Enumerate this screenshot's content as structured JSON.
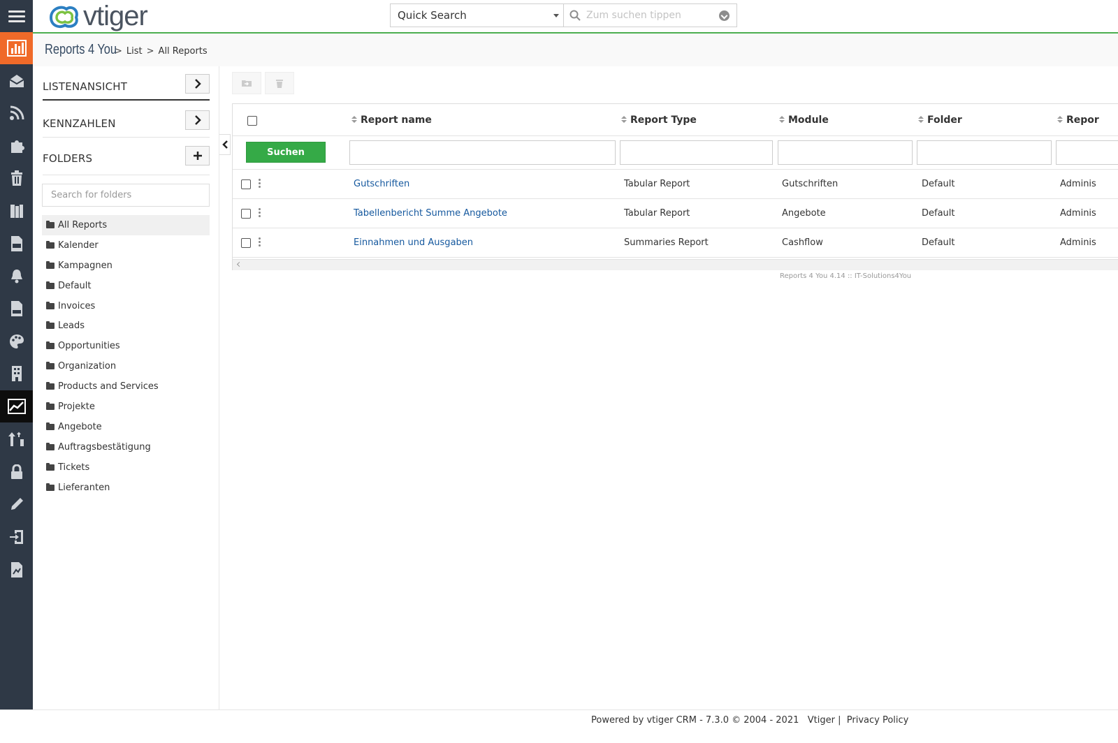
{
  "app": {
    "logo_text": "vtiger"
  },
  "search": {
    "scope_value": "Quick Search",
    "placeholder": "Zum suchen tippen"
  },
  "breadcrumb": {
    "module": "Reports 4 You",
    "items": [
      "List",
      "All Reports"
    ]
  },
  "sidebar_icons": [
    "bar-chart-icon",
    "envelope-icon",
    "rss-icon",
    "puzzle-icon",
    "trash-icon",
    "book-icon",
    "pdf-icon",
    "bell-icon",
    "mail-template-icon",
    "palette-icon",
    "building-icon",
    "area-chart-icon",
    "sort-icon",
    "lock-icon",
    "pencil-icon",
    "import-icon",
    "report-file-icon"
  ],
  "panel": {
    "list_view": "LISTENANSICHT",
    "kpis": "KENNZAHLEN",
    "folders": "FOLDERS",
    "folder_search_placeholder": "Search for folders",
    "folder_items": [
      "All Reports",
      "Kalender",
      "Kampagnen",
      "Default",
      "Invoices",
      "Leads",
      "Opportunities",
      "Organization",
      "Products and Services",
      "Projekte",
      "Angebote",
      "Auftragsbestätigung",
      "Tickets",
      "Lieferanten"
    ],
    "selected_folder": "All Reports"
  },
  "table": {
    "columns": [
      "Report name",
      "Report Type",
      "Module",
      "Folder",
      "Repor"
    ],
    "search_button": "Suchen",
    "rows": [
      {
        "name": "Gutschriften",
        "type": "Tabular Report",
        "module": "Gutschriften",
        "folder": "Default",
        "owner": "Adminis"
      },
      {
        "name": "Tabellenbericht Summe Angebote",
        "type": "Tabular Report",
        "module": "Angebote",
        "folder": "Default",
        "owner": "Adminis"
      },
      {
        "name": "Einnahmen und Ausgaben",
        "type": "Summaries Report",
        "module": "Cashflow",
        "folder": "Default",
        "owner": "Adminis"
      }
    ]
  },
  "credit": "Reports 4 You 4.14 :: IT-Solutions4You",
  "footer": {
    "powered": "Powered by vtiger CRM - 7.3.0  © 2004 - 2021",
    "vtiger_link": "Vtiger",
    "sep": "|",
    "privacy": "Privacy Policy"
  },
  "colors": {
    "rail": "#2f3946",
    "rail_active": "#f06a29",
    "header_accent": "#4caf50",
    "search_button": "#35aa47",
    "link": "#15589e"
  }
}
